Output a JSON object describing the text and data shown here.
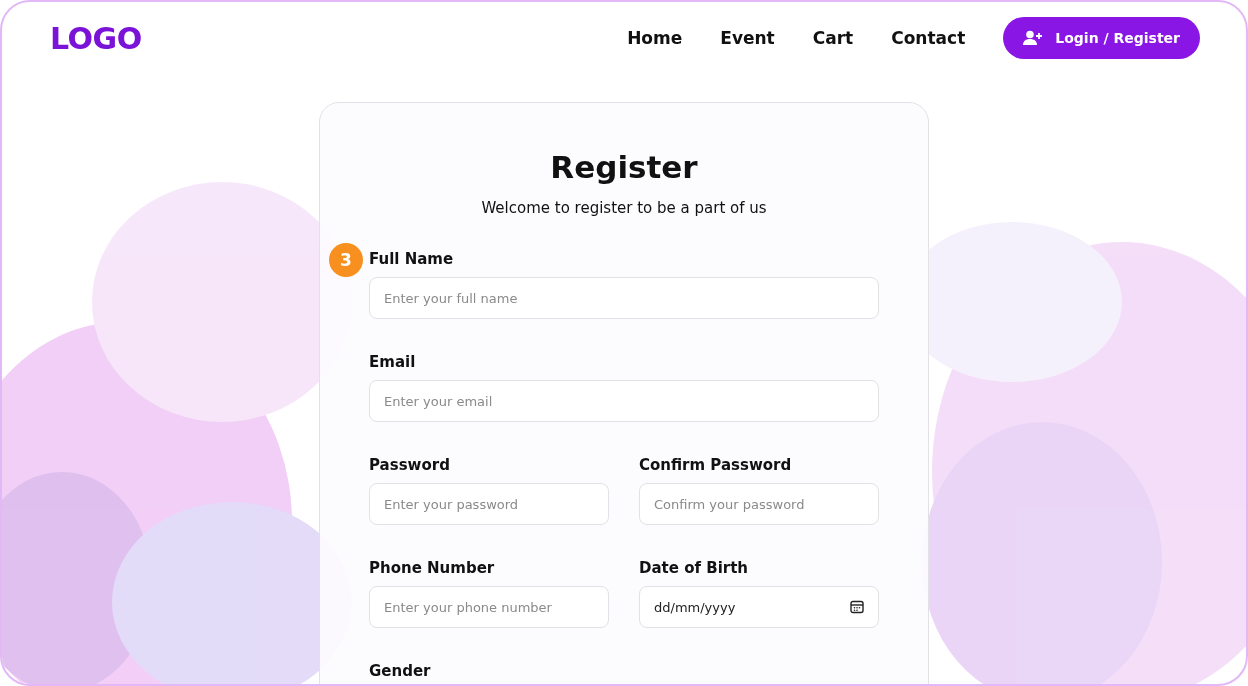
{
  "header": {
    "logo": "LOGO",
    "nav": [
      {
        "label": "Home"
      },
      {
        "label": "Event"
      },
      {
        "label": "Cart"
      },
      {
        "label": "Contact"
      }
    ],
    "button": "Login / Register"
  },
  "form": {
    "title": "Register",
    "subtitle": "Welcome to register to be a part of us",
    "step_badge": "3",
    "rows": [
      {
        "fields": [
          {
            "kind": "text",
            "label": "Full Name",
            "placeholder": "Enter your full name"
          }
        ]
      },
      {
        "fields": [
          {
            "kind": "text",
            "label": "Email",
            "placeholder": "Enter your email"
          }
        ]
      },
      {
        "fields": [
          {
            "kind": "text",
            "label": "Password",
            "placeholder": "Enter your password"
          },
          {
            "kind": "text",
            "label": "Confirm Password",
            "placeholder": "Confirm your password"
          }
        ]
      },
      {
        "fields": [
          {
            "kind": "text",
            "label": "Phone Number",
            "placeholder": "Enter your phone number"
          },
          {
            "kind": "date",
            "label": "Date of Birth",
            "value": "dd/mm/yyyy"
          }
        ]
      },
      {
        "fields": [
          {
            "kind": "label",
            "label": "Gender"
          }
        ]
      }
    ]
  }
}
